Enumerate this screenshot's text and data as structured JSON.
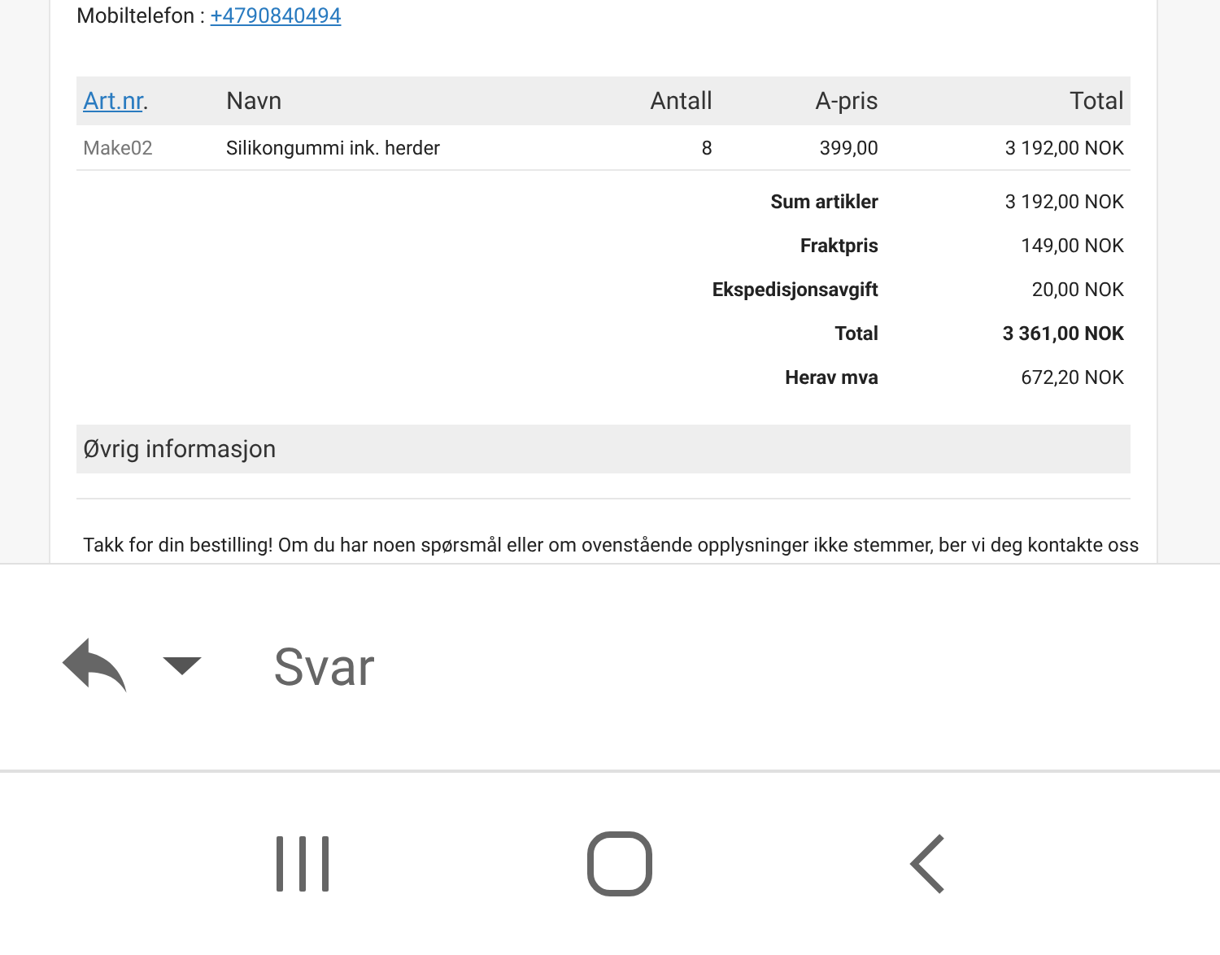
{
  "contact": {
    "label": "Mobiltelefon : ",
    "phone": "+4790840494"
  },
  "table": {
    "columns": [
      {
        "label": "Art.nr",
        "suffix": ".",
        "kind": "link"
      },
      {
        "label": "Navn",
        "kind": "text"
      },
      {
        "label": "Antall",
        "kind": "text"
      },
      {
        "label": "A-pris",
        "kind": "text"
      },
      {
        "label": "Total",
        "kind": "text"
      }
    ],
    "rows": [
      [
        "Make02",
        "Silikongummi ink. herder",
        "8",
        "399,00",
        "3 192,00 NOK"
      ]
    ]
  },
  "summary": [
    {
      "label": "Sum artikler",
      "value": "3 192,00 NOK",
      "bold": false
    },
    {
      "label": "Fraktpris",
      "value": "149,00 NOK",
      "bold": false
    },
    {
      "label": "Ekspedisjonsavgift",
      "value": "20,00 NOK",
      "bold": false
    },
    {
      "label": "Total",
      "value": "3 361,00 NOK",
      "bold": true
    },
    {
      "label": "Herav mva",
      "value": "672,20 NOK",
      "bold": false
    }
  ],
  "section": {
    "title": "Øvrig informasjon",
    "text": "Takk for din bestilling! Om du har noen spørsmål eller om ovenstående opplysninger ikke stemmer, ber vi deg kontakte oss"
  },
  "reply_bar": {
    "label": "Svar"
  }
}
